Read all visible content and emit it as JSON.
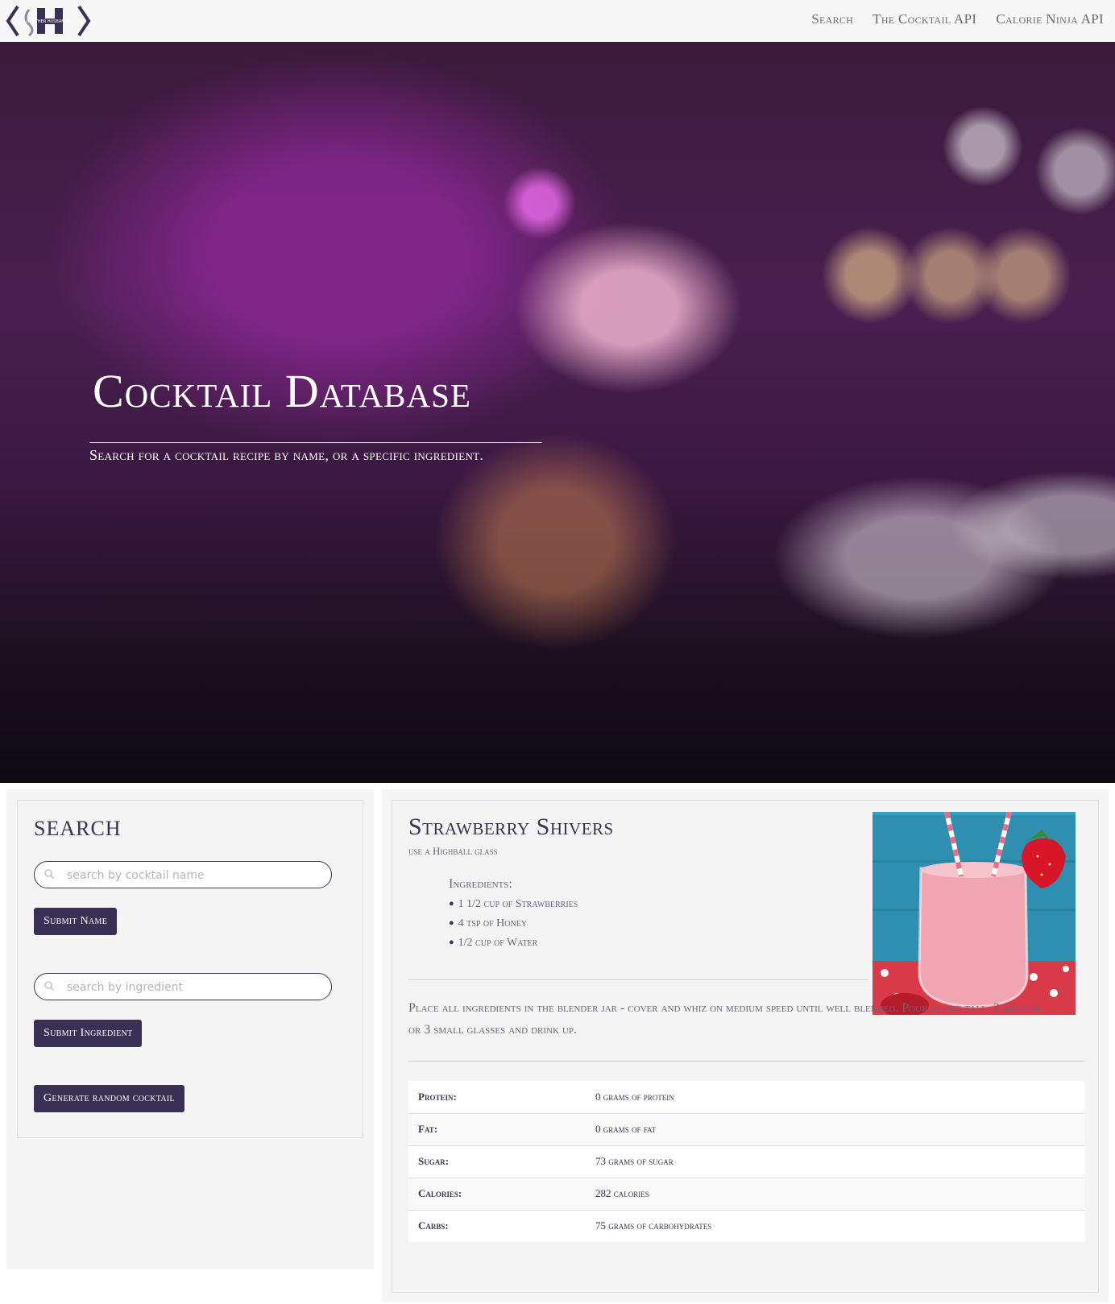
{
  "nav": {
    "logo_text": "BROTHER HUSBANDS",
    "links": [
      "Search",
      "The Cocktail API",
      "Calorie Ninja API"
    ]
  },
  "hero": {
    "title": "Cocktail Database",
    "subtitle": "Search for a cocktail recipe by name, or a specific ingredient."
  },
  "search": {
    "title": "SEARCH",
    "name_placeholder": "search by cocktail name",
    "name_button": "Submit Name",
    "ingredient_placeholder": "search by ingredient",
    "ingredient_button": "Submit Ingredient",
    "random_button": "Generate random cocktail"
  },
  "result": {
    "name": "Strawberry Shivers",
    "glass": "use a Highball glass",
    "ingredients_title": "Ingredients:",
    "ingredients": [
      "1 1/2 cup of Strawberries",
      "4 tsp of Honey",
      "1/2 cup of Water"
    ],
    "instructions": "Place all ingredients in the blender jar - cover and whiz on medium speed until well blended. Pour in one tall, 2 medium or 3 small glasses and drink up.",
    "nutrition": [
      {
        "label": "Protein:",
        "value": "0 grams of protein"
      },
      {
        "label": "Fat:",
        "value": "0 grams of fat"
      },
      {
        "label": "Sugar:",
        "value": "73 grams of sugar"
      },
      {
        "label": "Calories:",
        "value": "282 calories"
      },
      {
        "label": "Carbs:",
        "value": "75 grams of carbohydrates"
      }
    ]
  },
  "colors": {
    "accent": "#3a2f55",
    "panel": "#f4f4f4",
    "text": "#3b3450"
  }
}
